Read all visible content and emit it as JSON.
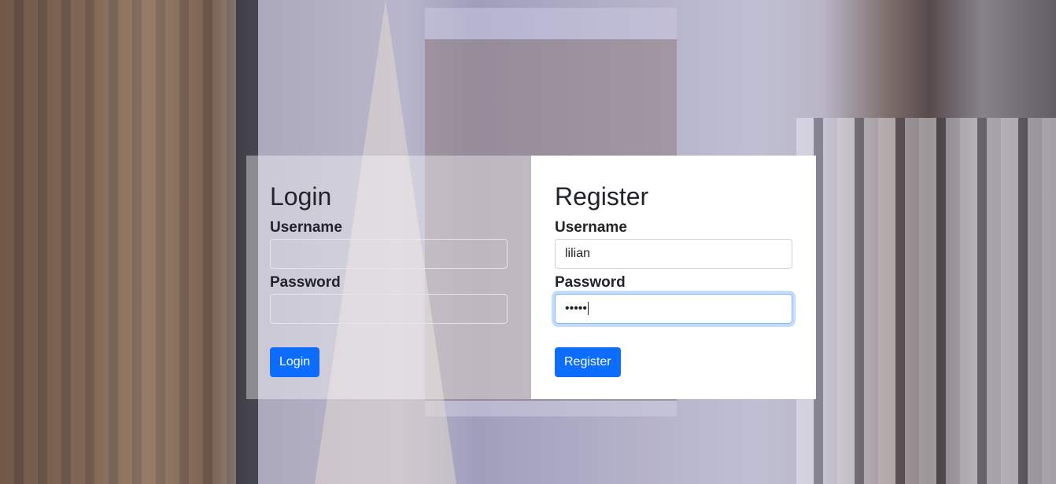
{
  "login": {
    "title": "Login",
    "username_label": "Username",
    "username_value": "",
    "password_label": "Password",
    "password_value": "",
    "button_label": "Login"
  },
  "register": {
    "title": "Register",
    "username_label": "Username",
    "username_value": "lilian",
    "password_label": "Password",
    "password_value": "•••••",
    "button_label": "Register"
  },
  "colors": {
    "primary": "#0d6efd",
    "focus_border": "#86b7fe"
  }
}
